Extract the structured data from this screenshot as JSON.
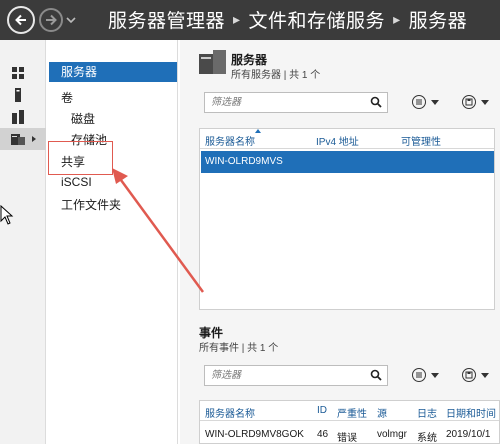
{
  "titlebar": {
    "crumbs": [
      "服务器管理器",
      "文件和存储服务",
      "服务器"
    ],
    "separator": "▸"
  },
  "nav": {
    "items": [
      {
        "label": "服务器",
        "selected": true
      },
      {
        "label": "卷"
      },
      {
        "label": "磁盘"
      },
      {
        "label": "存储池"
      },
      {
        "label": "共享"
      },
      {
        "label": "iSCSI"
      },
      {
        "label": "工作文件夹"
      }
    ]
  },
  "servers": {
    "title": "服务器",
    "subtitle": "所有服务器 | 共 1 个",
    "filter_placeholder": "筛选器",
    "columns": [
      "服务器名称",
      "IPv4 地址",
      "可管理性"
    ],
    "rows": [
      {
        "name": "WIN-OLRD9MVS"
      }
    ]
  },
  "events": {
    "title": "事件",
    "subtitle": "所有事件 | 共 1 个",
    "filter_placeholder": "筛选器",
    "columns": [
      "服务器名称",
      "ID",
      "严重性",
      "源",
      "日志",
      "日期和时间"
    ],
    "rows": [
      {
        "server": "WIN-OLRD9MV8GOK",
        "id": "46",
        "severity": "错误",
        "source": "volmgr",
        "log": "系统",
        "datetime": "2019/10/1"
      }
    ]
  },
  "colors": {
    "titlebar": "#3b3b3b",
    "selection": "#1f6fb8",
    "annotation": "#e05a50"
  }
}
